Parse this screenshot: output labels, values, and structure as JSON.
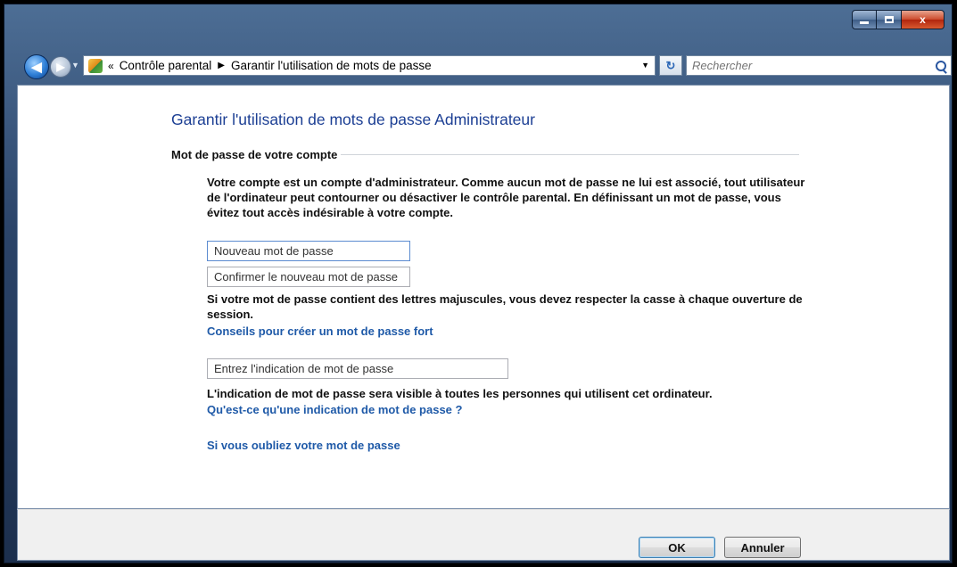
{
  "window": {
    "caption_buttons": {
      "close_glyph": "x"
    }
  },
  "navigation": {
    "back_glyph": "◀",
    "forward_glyph": "▶",
    "breadcrumb_prefix": "«",
    "breadcrumb": [
      "Contrôle parental",
      "Garantir l'utilisation de mots de passe"
    ],
    "breadcrumb_separator": "▶",
    "refresh_glyph": "↻",
    "search_placeholder": "Rechercher"
  },
  "main": {
    "title": "Garantir l'utilisation de mots de passe Administrateur",
    "group_label": "Mot de passe de votre compte",
    "intro": "Votre compte est un compte d'administrateur. Comme aucun mot de passe ne lui est associé, tout utilisateur de l'ordinateur peut contourner ou désactiver le contrôle parental. En définissant un mot de passe, vous évitez tout accès indésirable à votre compte.",
    "new_password_placeholder": "Nouveau mot de passe",
    "confirm_password_placeholder": "Confirmer le nouveau mot de passe",
    "case_note": "Si votre mot de passe contient des lettres majuscules, vous devez respecter la casse à chaque ouverture de session.",
    "strong_password_link": "Conseils pour créer un mot de passe fort",
    "hint_placeholder": "Entrez l'indication de mot de passe",
    "hint_note": "L'indication de mot de passe sera visible à toutes les personnes qui utilisent cet ordinateur.",
    "hint_help_link": "Qu'est-ce qu'une indication de mot de passe ?",
    "forgot_link": "Si vous oubliez votre mot de passe"
  },
  "buttons": {
    "ok": "OK",
    "cancel": "Annuler"
  }
}
